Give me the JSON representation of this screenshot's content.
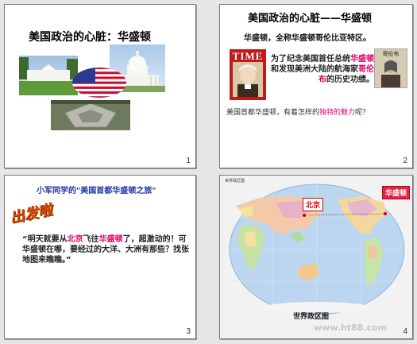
{
  "slides": [
    {
      "number": "1",
      "title": "美国政治的心脏：华盛顿"
    },
    {
      "number": "2",
      "title": "美国政治的心脏——华盛顿",
      "subtitle": "华盛顿，全称华盛顿哥伦比亚特区。",
      "time_label": "TIME",
      "portrait_label": "哥伦布",
      "body_a": "为了纪念美国首任总统",
      "body_b": "华盛顿",
      "body_c": "和发现美洲大陆的航海家",
      "body_d": "哥伦布",
      "body_e": "的历史功绩。",
      "question_a": "美国首都华盛顿，有着怎样的",
      "question_b": "独特的魅力",
      "question_c": "呢？"
    },
    {
      "number": "3",
      "heading": "小军同学的\"美国首都华盛顿之旅\"",
      "wordart": "出发啦",
      "quote_a": "“明天就要从",
      "quote_b": "北京",
      "quote_c": "飞往",
      "quote_d": "华盛顿",
      "quote_e": "了，超激动的！可华盛顿在哪，要经过的大洋、大洲有那些？找张地图来瞧瞧。”"
    },
    {
      "number": "4",
      "map_title": "世界政区图",
      "map_caption": "世界政区图",
      "label_beijing": "北京",
      "label_washington": "华盛顿",
      "watermark": "www.ht88.com"
    }
  ],
  "colors": {
    "accent_pink": "#e0006b",
    "heading_blue": "#2035a0",
    "ocean": "#bcd6f0"
  }
}
